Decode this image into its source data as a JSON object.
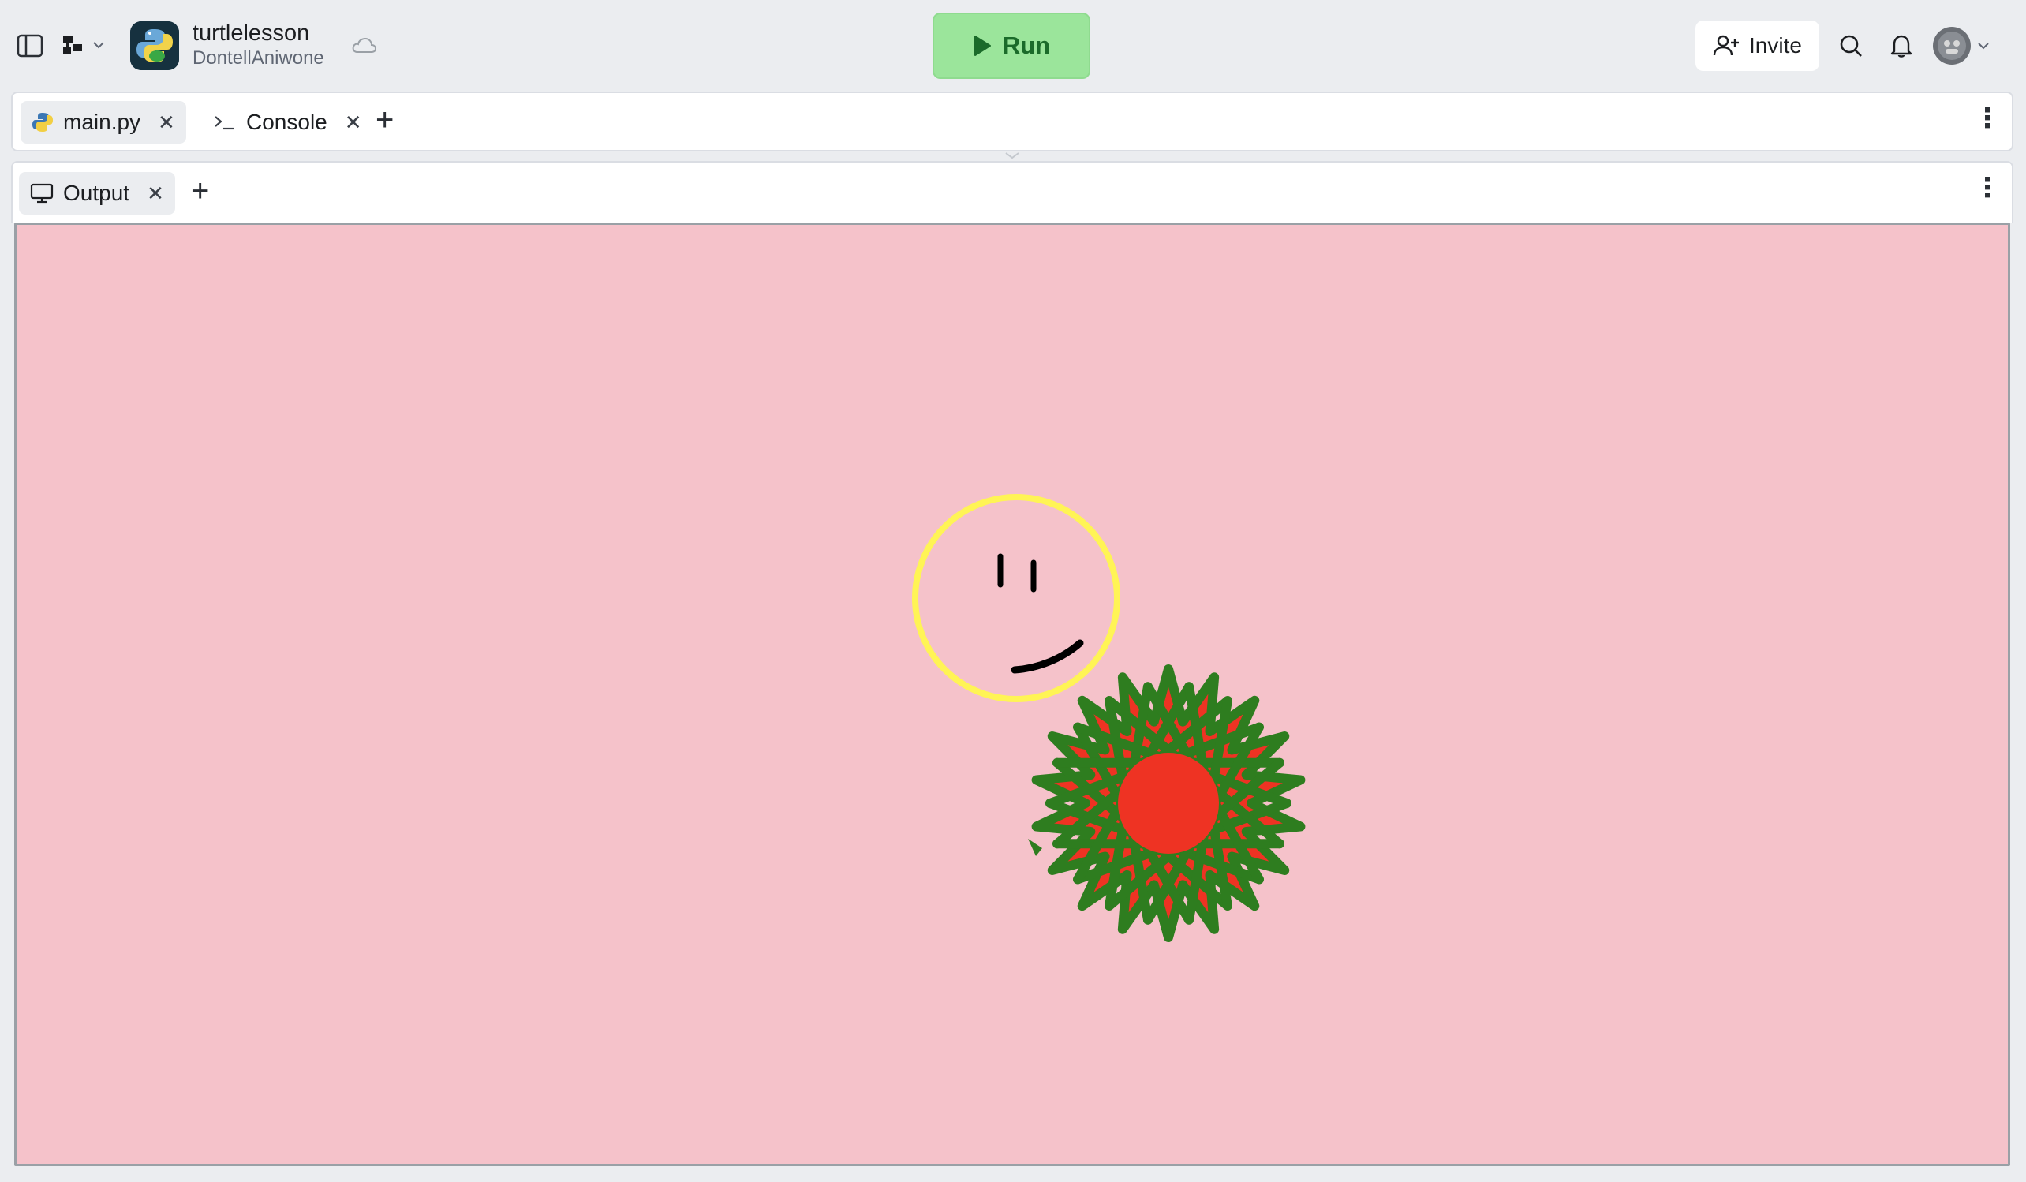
{
  "topbar": {
    "repl_title": "turtlelesson",
    "repl_owner": "DontellAniwone",
    "run_label": "Run",
    "invite_label": "Invite",
    "icons": [
      "sidebar-toggle-icon",
      "file-tree-icon",
      "chevron-down-icon",
      "python-logo-icon",
      "cloud-icon",
      "play-icon",
      "add-user-icon",
      "search-icon",
      "bell-icon",
      "avatar"
    ]
  },
  "editor_tabs": {
    "tabs": [
      {
        "label": "main.py",
        "icon": "python-file-icon",
        "active": true
      },
      {
        "label": "Console",
        "icon": "terminal-icon",
        "active": false
      }
    ]
  },
  "output_tabs": {
    "tabs": [
      {
        "label": "Output",
        "icon": "monitor-icon",
        "active": true
      }
    ]
  },
  "canvas": {
    "background": "#f5c2ca",
    "drawing": [
      "smiley-face",
      "star-flower"
    ],
    "colors": {
      "face_outline": "#fff455",
      "features": "#000000",
      "petals": "#2e7d1f",
      "petal_fill": "#ee3323",
      "center": "#ee3323"
    }
  },
  "colors": {
    "run_bg": "#9be59b",
    "run_text": "#1b6b2a",
    "chrome": "#ebedf0"
  }
}
